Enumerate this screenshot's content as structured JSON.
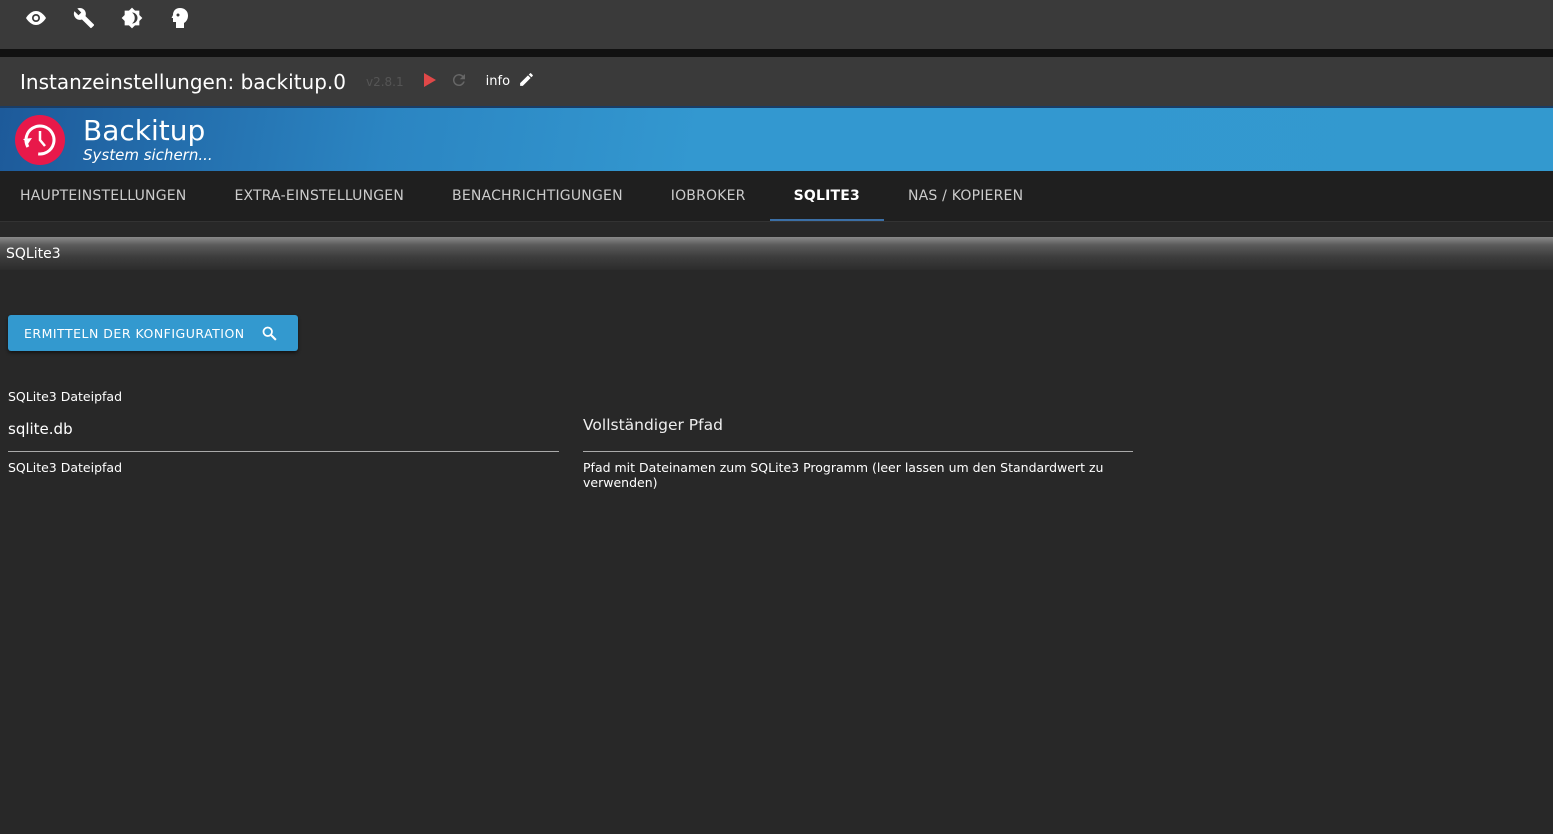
{
  "topbar": {
    "icons": [
      "eye-icon",
      "wrench-icon",
      "brightness-icon",
      "head-icon"
    ]
  },
  "titlebar": {
    "title": "Instanzeinstellungen: backitup.0",
    "version": "v2.8.1",
    "info": "info"
  },
  "banner": {
    "name": "Backitup",
    "subtitle": "System sichern..."
  },
  "tabs": [
    {
      "label": "HAUPTEINSTELLUNGEN"
    },
    {
      "label": "EXTRA-EINSTELLUNGEN"
    },
    {
      "label": "BENACHRICHTIGUNGEN"
    },
    {
      "label": "IOBROKER"
    },
    {
      "label": "SQLITE3",
      "active": true
    },
    {
      "label": "NAS / KOPIEREN"
    }
  ],
  "section": {
    "title": "SQLite3"
  },
  "form": {
    "detect_button": "ERMITTELN DER KONFIGURATION",
    "path_label": "SQLite3 Dateipfad",
    "path_value": "sqlite.db",
    "path_help": "SQLite3 Dateipfad",
    "full_path_label": "Vollständiger Pfad",
    "full_path_value": "",
    "full_path_help": "Pfad mit Dateinamen zum SQLite3 Programm (leer lassen um den Standardwert zu verwenden)"
  },
  "colors": {
    "accent": "#3399cf",
    "logo": "#e8194a",
    "play": "#e04848"
  }
}
